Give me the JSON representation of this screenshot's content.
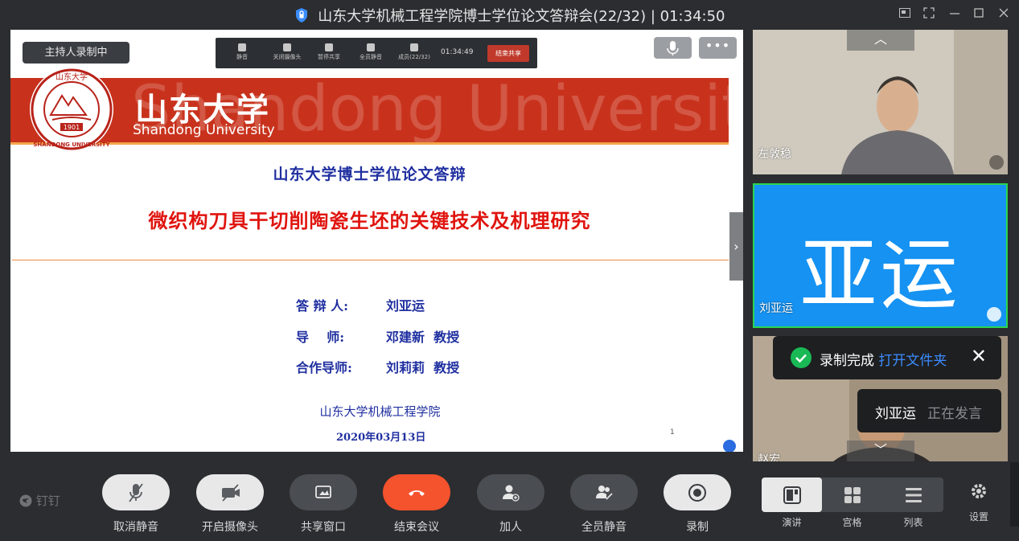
{
  "window": {
    "title": "山东大学机械工程学院博士学位论文答辩会(22/32) | 01:34:50"
  },
  "share": {
    "recording_badge": "主持人录制中",
    "mini_toolbar": {
      "items": [
        "静音",
        "关闭摄像头",
        "暂停共享",
        "全员静音",
        "成员(22/32)"
      ],
      "time": "01:34:49",
      "stop_label": "结束共享"
    },
    "more_label": "•••"
  },
  "slide": {
    "watermark": "Shandong University",
    "brand_cn": "山东大学",
    "brand_en": "Shandong University",
    "logo_year": "1901",
    "logo_text": "SHANDONG UNIVERSITY",
    "heading": "山东大学博士学位论文答辩",
    "thesis_title": "微织构刀具干切削陶瓷生坯的关键技术及机理研究",
    "rows": [
      {
        "label": "答 辩 人:",
        "value": "刘亚运"
      },
      {
        "label": "导    师:",
        "value": "邓建新  教授"
      },
      {
        "label": "合作导师:",
        "value": "刘莉莉  教授"
      }
    ],
    "institute": "山东大学机械工程学院",
    "date": "2020年03月13日",
    "page_no": "1"
  },
  "videos": [
    {
      "name": "左敦稳"
    },
    {
      "name": "刘亚运",
      "avatar": "亚运"
    },
    {
      "name": "赵宏"
    }
  ],
  "toast": {
    "message": "录制完成",
    "link": "打开文件夹"
  },
  "speaker": {
    "name": "刘亚运",
    "status": "正在发言"
  },
  "toolbar": {
    "brand": "钉钉",
    "buttons": [
      "取消静音",
      "开启摄像头",
      "共享窗口",
      "结束会议",
      "加人",
      "全员静音",
      "录制"
    ],
    "views": [
      "演讲",
      "宫格",
      "列表"
    ],
    "settings": "设置"
  },
  "colors": {
    "banner": "#c8321c",
    "end_call": "#f5522e",
    "active_border": "#2bd44f",
    "avatar_bg": "#1592f2",
    "link": "#3b8cff"
  }
}
